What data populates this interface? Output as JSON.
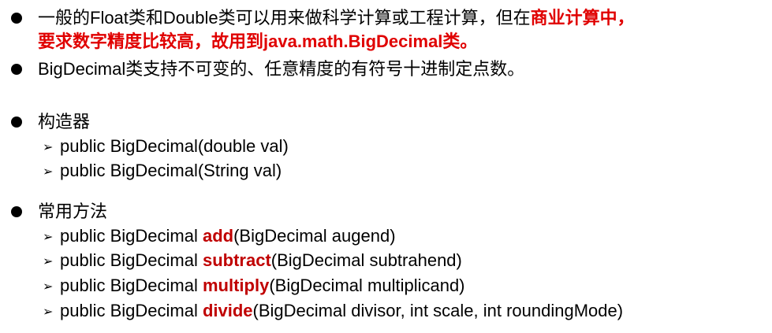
{
  "bullets": {
    "b1": {
      "line1_plain": "一般的Float类和Double类可以用来做科学计算或工程计算，但在",
      "line1_red": "商业计算中，",
      "line2_red": "要求数字精度比较高，故用到java.math.BigDecimal类。"
    },
    "b2": {
      "text": "BigDecimal类支持不可变的、任意精度的有符号十进制定点数。"
    },
    "b3": {
      "title": "构造器",
      "items": [
        {
          "text": "public BigDecimal(double val)"
        },
        {
          "text": "public BigDecimal(String val)"
        }
      ]
    },
    "b4": {
      "title": "常用方法",
      "items": [
        {
          "prefix": "public BigDecimal ",
          "method": "add",
          "suffix": "(BigDecimal augend)"
        },
        {
          "prefix": "public BigDecimal ",
          "method": "subtract",
          "suffix": "(BigDecimal subtrahend)"
        },
        {
          "prefix": "public BigDecimal ",
          "method": "multiply",
          "suffix": "(BigDecimal multiplicand)"
        },
        {
          "prefix": "public BigDecimal ",
          "method": "divide",
          "suffix": "(BigDecimal divisor, int scale, int roundingMode)"
        }
      ]
    }
  },
  "glyphs": {
    "sub_arrow": "➢"
  },
  "colors": {
    "highlight": "#e00000",
    "method": "#c00000"
  }
}
